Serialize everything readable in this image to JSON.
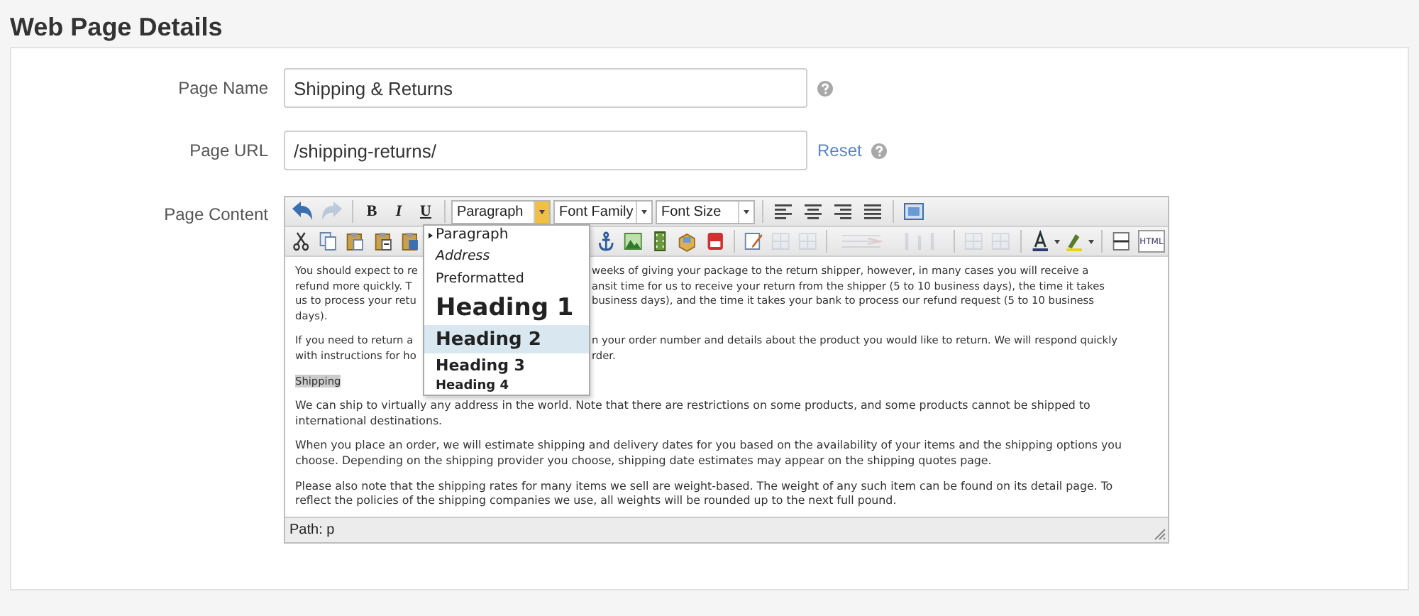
{
  "page": {
    "title": "Web Page Details"
  },
  "fields": [
    {
      "kind": "text",
      "label": "Page Name",
      "value": "Shipping & Returns",
      "help": true
    },
    {
      "kind": "text",
      "label": "Page URL",
      "value": "/shipping-returns/",
      "link": "Reset",
      "help": true
    },
    {
      "kind": "editor",
      "label": "Page Content"
    }
  ],
  "editor": {
    "toolbar_1": [
      {
        "kind": "icon",
        "disabled": false
      },
      {
        "kind": "icon",
        "disabled": true
      },
      {
        "kind": "separator"
      },
      {
        "kind": "text",
        "label": "B",
        "disabled": false
      },
      {
        "kind": "text",
        "label": "I",
        "disabled": false
      },
      {
        "kind": "text",
        "label": "U",
        "disabled": false
      },
      {
        "kind": "separator"
      },
      {
        "kind": "select",
        "label": "Paragraph",
        "open": true
      },
      {
        "kind": "select",
        "label": "Font Family",
        "open": false
      },
      {
        "kind": "select",
        "label": "Font Size",
        "open": false
      },
      {
        "kind": "separator"
      },
      {
        "kind": "icon",
        "disabled": false
      },
      {
        "kind": "icon",
        "disabled": false
      },
      {
        "kind": "icon",
        "disabled": false
      },
      {
        "kind": "icon",
        "disabled": false
      },
      {
        "kind": "separator"
      },
      {
        "kind": "icon",
        "disabled": false
      }
    ],
    "toolbar_2": [
      {
        "kind": "icon",
        "disabled": false
      },
      {
        "kind": "icon",
        "disabled": false
      },
      {
        "kind": "icon",
        "disabled": false
      },
      {
        "kind": "icon",
        "disabled": false
      },
      {
        "kind": "icon",
        "disabled": false
      },
      {
        "kind": "covered"
      },
      {
        "kind": "icon",
        "disabled": false
      },
      {
        "kind": "icon",
        "disabled": false
      },
      {
        "kind": "icon",
        "disabled": false
      },
      {
        "kind": "icon",
        "disabled": false
      },
      {
        "kind": "icon",
        "disabled": false
      },
      {
        "kind": "separator"
      },
      {
        "kind": "icon",
        "disabled": false
      },
      {
        "kind": "icon",
        "disabled": true
      },
      {
        "kind": "icon",
        "disabled": true
      },
      {
        "kind": "separator"
      },
      {
        "kind": "icon",
        "disabled": true
      },
      {
        "kind": "icon",
        "disabled": true
      },
      {
        "kind": "separator"
      },
      {
        "kind": "icon",
        "disabled": true
      },
      {
        "kind": "icon",
        "disabled": true
      },
      {
        "kind": "separator"
      },
      {
        "kind": "icon",
        "disabled": false
      },
      {
        "kind": "icon",
        "disabled": false
      },
      {
        "kind": "separator"
      },
      {
        "kind": "icon",
        "disabled": false
      },
      {
        "kind": "text",
        "label": "HTML",
        "disabled": false
      }
    ],
    "format_menu": [
      {
        "kind": "paragraph",
        "label": "Paragraph",
        "selected": true,
        "highlighted": false
      },
      {
        "kind": "address",
        "label": "Address",
        "selected": false,
        "highlighted": false
      },
      {
        "kind": "pre",
        "label": "Preformatted",
        "selected": false,
        "highlighted": false
      },
      {
        "kind": "h1",
        "label": "Heading 1",
        "selected": false,
        "highlighted": false
      },
      {
        "kind": "h2",
        "label": "Heading 2",
        "selected": false,
        "highlighted": true
      },
      {
        "kind": "h3",
        "label": "Heading 3",
        "selected": false,
        "highlighted": false
      },
      {
        "kind": "h4",
        "label": "Heading 4",
        "selected": false,
        "highlighted": false
      }
    ],
    "content": [
      {
        "kind": "split",
        "lines": [
          {
            "left": "You should expect to re",
            "right": "weeks of giving your package to the return shipper, however, in many cases you will receive a"
          },
          {
            "left": "refund more quickly. T",
            "right": "ansit time for us to receive your return from the shipper (5 to 10 business days), the time it takes"
          },
          {
            "left": "us to process your retu",
            "right": "business days), and the time it takes your bank to process our refund request (5 to 10 business"
          },
          {
            "left": "days)."
          }
        ]
      },
      {
        "kind": "split",
        "lines": [
          {
            "left": "If you need to return a",
            "right": "n your order number and details about the product you would like to return. We will respond quickly"
          },
          {
            "left": "with instructions for ho",
            "right": "rder."
          }
        ]
      },
      {
        "kind": "highlighted",
        "text": "Shipping"
      },
      {
        "kind": "paragraph",
        "text": "We can ship to virtually any address in the world. Note that there are restrictions on some products, and some products cannot be shipped to international destinations."
      },
      {
        "kind": "paragraph",
        "text": "When you place an order, we will estimate shipping and delivery dates for you based on the availability of your items and the shipping options you choose. Depending on the shipping provider you choose, shipping date estimates may appear on the shipping quotes page."
      },
      {
        "kind": "paragraph",
        "text": "Please also note that the shipping rates for many items we sell are weight-based. The weight of any such item can be found on its detail page. To reflect the policies of the shipping companies we use, all weights will be rounded up to the next full pound."
      }
    ],
    "path": "Path: p"
  }
}
